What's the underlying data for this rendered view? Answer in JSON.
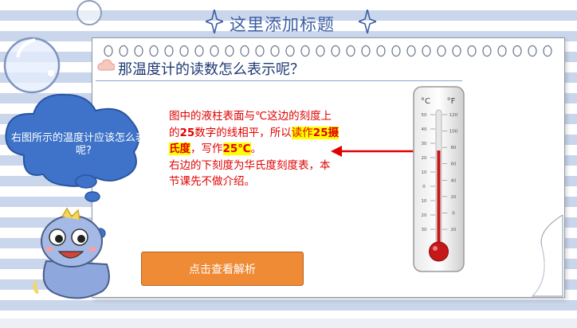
{
  "slide": {
    "title": "这里添加标题",
    "question": "那温度计的读数怎么表示呢？",
    "cloud_text": "右图所示的温度计应该怎么表示呢?",
    "explanation": {
      "line1": "图中的液柱表面与℃这边的刻度上的",
      "num25": "25",
      "line2": "数字的线相平，所以",
      "read_as": "读作",
      "read_value": "25摄氏度",
      "write_as": "，写作",
      "write_value": "25℃",
      "period": "。",
      "line3": "右边的下刻度为华氏度刻度表，本节课先不做介绍。"
    },
    "button_label": "点击查看解析"
  },
  "thermometer": {
    "celsius_unit": "°C",
    "fahrenheit_unit": "°F",
    "celsius_ticks": [
      "50",
      "40",
      "30",
      "20",
      "10",
      "0",
      "10",
      "20",
      "30"
    ],
    "fahrenheit_ticks": [
      "120",
      "100",
      "80",
      "60",
      "40",
      "20",
      "0",
      "20"
    ],
    "reading_celsius": 25
  },
  "colors": {
    "title": "#3e5fa3",
    "explanation_text": "#e00000",
    "highlight": "#ffff00",
    "button": "#ef8a35",
    "cloud": "#3e73c9",
    "mercury": "#c51818"
  }
}
